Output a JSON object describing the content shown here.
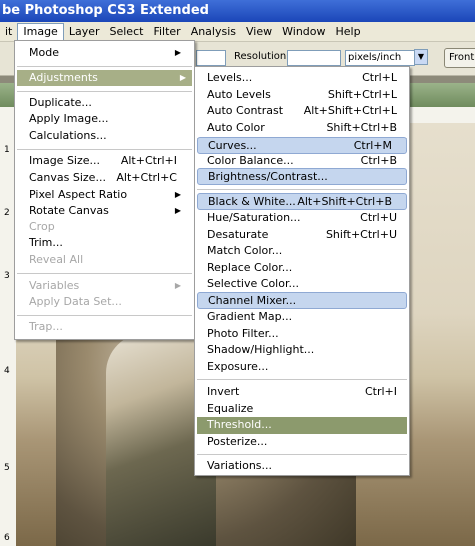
{
  "app_title": "be Photoshop CS3 Extended",
  "menubar": [
    {
      "label": "it",
      "active": false
    },
    {
      "label": "Image",
      "active": true
    },
    {
      "label": "Layer",
      "active": false
    },
    {
      "label": "Select",
      "active": false
    },
    {
      "label": "Filter",
      "active": false
    },
    {
      "label": "Analysis",
      "active": false
    },
    {
      "label": "View",
      "active": false
    },
    {
      "label": "Window",
      "active": false
    },
    {
      "label": "Help",
      "active": false
    }
  ],
  "options_bar": {
    "resolution_label": "Resolution:",
    "resolution_value": "",
    "units_value": "pixels/inch",
    "front_button": "Front"
  },
  "rulers": {
    "left_marks": [
      "1",
      "2",
      "3",
      "4",
      "5",
      "6"
    ]
  },
  "image_menu": [
    {
      "label": "Mode",
      "shortcut": "",
      "submenu": true,
      "disabled": false
    },
    {
      "label": "Adjustments",
      "shortcut": "",
      "submenu": true,
      "disabled": false,
      "highlighted": true
    },
    {
      "label": "Duplicate...",
      "shortcut": "",
      "disabled": false
    },
    {
      "label": "Apply Image...",
      "shortcut": "",
      "disabled": false
    },
    {
      "label": "Calculations...",
      "shortcut": "",
      "disabled": false
    },
    {
      "label": "Image Size...",
      "shortcut": "Alt+Ctrl+I",
      "disabled": false
    },
    {
      "label": "Canvas Size...",
      "shortcut": "Alt+Ctrl+C",
      "disabled": false
    },
    {
      "label": "Pixel Aspect Ratio",
      "shortcut": "",
      "submenu": true,
      "disabled": false
    },
    {
      "label": "Rotate Canvas",
      "shortcut": "",
      "submenu": true,
      "disabled": false
    },
    {
      "label": "Crop",
      "shortcut": "",
      "disabled": true
    },
    {
      "label": "Trim...",
      "shortcut": "",
      "disabled": false
    },
    {
      "label": "Reveal All",
      "shortcut": "",
      "disabled": true
    },
    {
      "label": "Variables",
      "shortcut": "",
      "submenu": true,
      "disabled": true
    },
    {
      "label": "Apply Data Set...",
      "shortcut": "",
      "disabled": true
    },
    {
      "label": "Trap...",
      "shortcut": "",
      "disabled": true
    }
  ],
  "adjustments_menu": [
    {
      "label": "Levels...",
      "shortcut": "Ctrl+L"
    },
    {
      "label": "Auto Levels",
      "shortcut": "Shift+Ctrl+L"
    },
    {
      "label": "Auto Contrast",
      "shortcut": "Alt+Shift+Ctrl+L"
    },
    {
      "label": "Auto Color",
      "shortcut": "Shift+Ctrl+B"
    },
    {
      "label": "Curves...",
      "shortcut": "Ctrl+M",
      "marked": true
    },
    {
      "label": "Color Balance...",
      "shortcut": "Ctrl+B"
    },
    {
      "label": "Brightness/Contrast...",
      "shortcut": "",
      "marked": true
    },
    {
      "label": "Black & White...",
      "shortcut": "Alt+Shift+Ctrl+B",
      "marked": true
    },
    {
      "label": "Hue/Saturation...",
      "shortcut": "Ctrl+U"
    },
    {
      "label": "Desaturate",
      "shortcut": "Shift+Ctrl+U"
    },
    {
      "label": "Match Color...",
      "shortcut": ""
    },
    {
      "label": "Replace Color...",
      "shortcut": ""
    },
    {
      "label": "Selective Color...",
      "shortcut": ""
    },
    {
      "label": "Channel Mixer...",
      "shortcut": "",
      "marked": true
    },
    {
      "label": "Gradient Map...",
      "shortcut": ""
    },
    {
      "label": "Photo Filter...",
      "shortcut": ""
    },
    {
      "label": "Shadow/Highlight...",
      "shortcut": ""
    },
    {
      "label": "Exposure...",
      "shortcut": ""
    },
    {
      "label": "Invert",
      "shortcut": "Ctrl+I"
    },
    {
      "label": "Equalize",
      "shortcut": ""
    },
    {
      "label": "Threshold...",
      "shortcut": "",
      "hover": true
    },
    {
      "label": "Posterize...",
      "shortcut": ""
    },
    {
      "label": "Variations...",
      "shortcut": ""
    }
  ]
}
